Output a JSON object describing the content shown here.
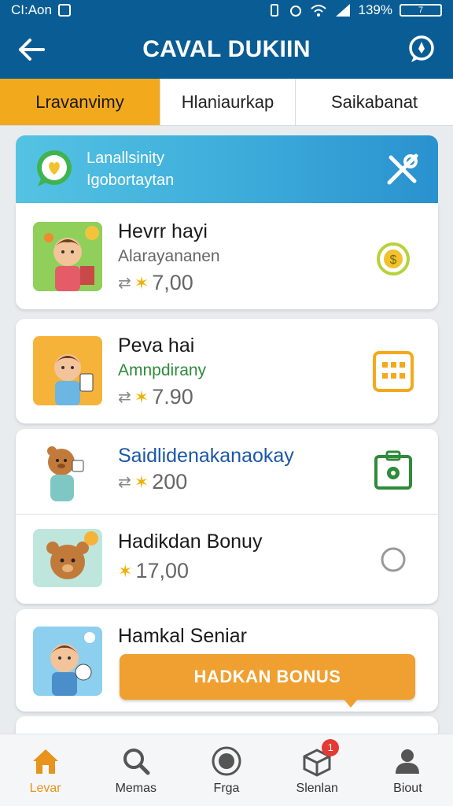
{
  "status": {
    "time": "CI:Aon",
    "battery": "139%",
    "battery_label": "7"
  },
  "appbar": {
    "title": "CAVAL DUKIIN",
    "back_icon": "back-arrow-icon",
    "action_icon": "chat-search-icon"
  },
  "tabs": [
    {
      "label": "Lravanvimy",
      "active": true
    },
    {
      "label": "Hlaniaurkap",
      "active": false
    },
    {
      "label": "Saikabanat",
      "active": false
    }
  ],
  "banner": {
    "line1": "Lanallsinity",
    "line2": "Igobortaytan"
  },
  "items": [
    {
      "title": "Hevrr hayi",
      "subtitle": "Alarayananen",
      "price": "7,00",
      "icon": "coin-icon"
    },
    {
      "title": "Peva hai",
      "subtitle": "Amnpdirany",
      "price": "7.90",
      "icon": "grid-icon"
    },
    {
      "title": "Saidlidenakanaokay",
      "subtitle": "",
      "price": "200",
      "icon": "bag-icon"
    },
    {
      "title": "Hadikdan Bonuy",
      "subtitle": "",
      "price": "17,00",
      "icon": "radio-icon"
    },
    {
      "title": "Hamkal Seniar",
      "button": "HADKAN BONUS"
    }
  ],
  "nav": [
    {
      "label": "Levar",
      "icon": "home-icon",
      "active": true
    },
    {
      "label": "Memas",
      "icon": "search-icon",
      "active": false
    },
    {
      "label": "Frga",
      "icon": "record-icon",
      "active": false
    },
    {
      "label": "Slenlan",
      "icon": "box-icon",
      "active": false,
      "badge": "1"
    },
    {
      "label": "Biout",
      "icon": "profile-icon",
      "active": false
    }
  ],
  "colors": {
    "primary": "#0a5d94",
    "accent": "#f3a91c",
    "bonus": "#f0a030",
    "green": "#2e8b3a",
    "blue_text": "#1a57a8"
  }
}
